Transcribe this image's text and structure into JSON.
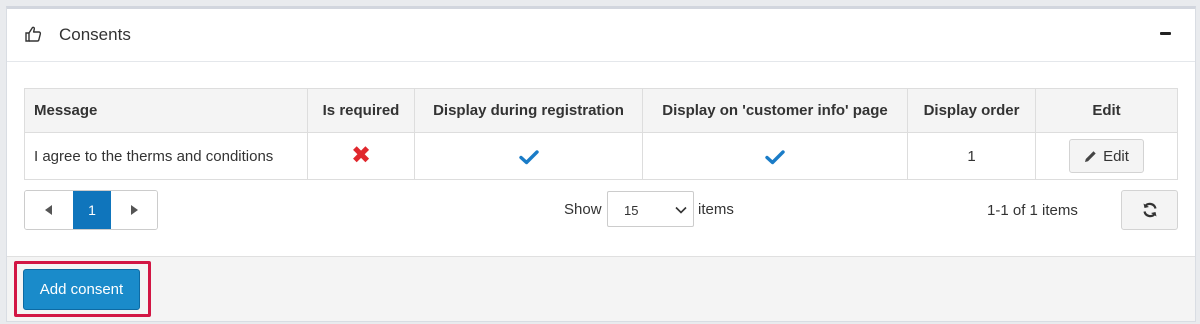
{
  "card": {
    "title": "Consents",
    "header_icon": "thumbs-up-icon",
    "collapse_icon": "minus-icon"
  },
  "table": {
    "columns": [
      "Message",
      "Is required",
      "Display during registration",
      "Display on 'customer info' page",
      "Display order",
      "Edit"
    ],
    "rows": [
      {
        "message": "I agree to the therms and conditions",
        "is_required": false,
        "display_during_registration": true,
        "display_on_customer_info": true,
        "display_order": "1",
        "edit_label": "Edit"
      }
    ]
  },
  "pager": {
    "prev_icon": "triangle-left-icon",
    "next_icon": "triangle-right-icon",
    "current_page": "1",
    "show_label": "Show",
    "page_size": "15",
    "items_label": "items",
    "range_text": "1-1 of 1 items",
    "refresh_icon": "refresh-icon"
  },
  "footer": {
    "add_button": "Add consent"
  },
  "colors": {
    "accent": "#1a8bca",
    "active_page": "#0f75bc",
    "check": "#1a7cc7",
    "cross": "#e0272d",
    "highlight": "#d21644"
  }
}
